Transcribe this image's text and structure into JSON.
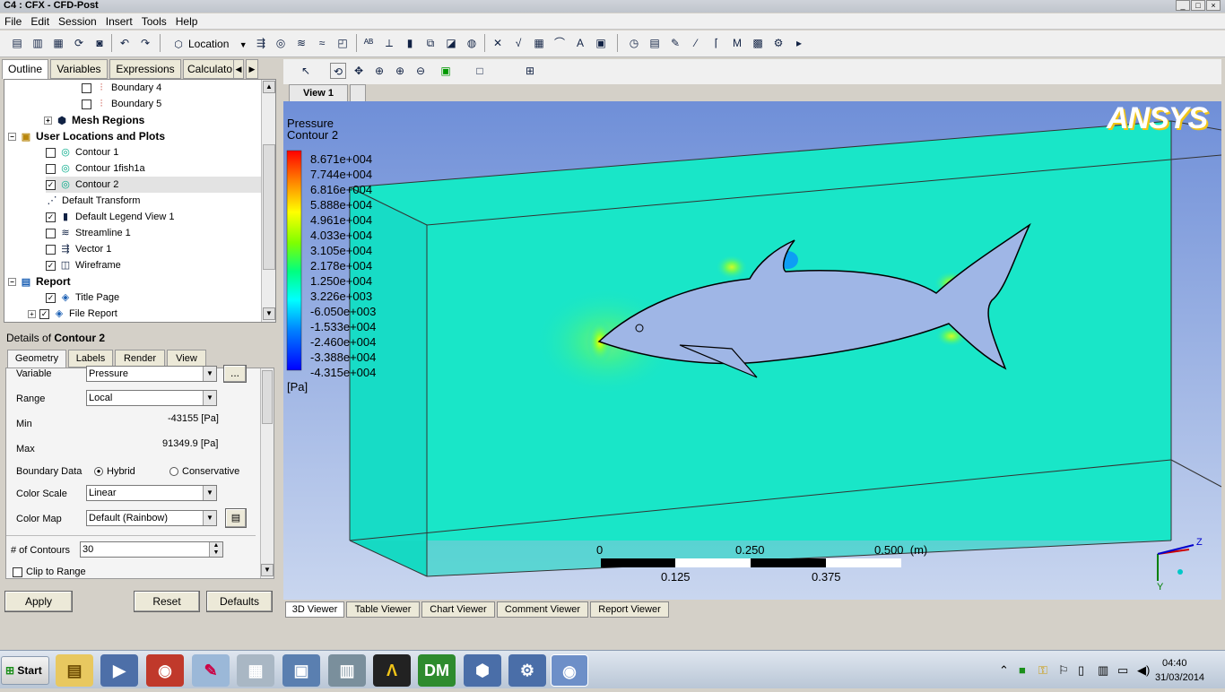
{
  "window": {
    "title": "C4 : CFX - CFD-Post"
  },
  "menu": [
    "File",
    "Edit",
    "Session",
    "Insert",
    "Tools",
    "Help"
  ],
  "toolbar": {
    "location_label": "Location"
  },
  "left_tabs": [
    "Outline",
    "Variables",
    "Expressions",
    "Calculato"
  ],
  "tree": {
    "boundary4": "Boundary 4",
    "boundary5": "Boundary 5",
    "mesh_regions": "Mesh Regions",
    "user_locations": "User Locations and Plots",
    "contour1": "Contour 1",
    "contour1fish": "Contour 1fish1a",
    "contour2": "Contour 2",
    "default_transform": "Default Transform",
    "default_legend": "Default Legend View 1",
    "streamline1": "Streamline 1",
    "vector1": "Vector 1",
    "wireframe": "Wireframe",
    "report": "Report",
    "title_page": "Title Page",
    "file_report": "File Report"
  },
  "details": {
    "prefix": "Details of ",
    "object": "Contour 2",
    "tabs": [
      "Geometry",
      "Labels",
      "Render",
      "View"
    ],
    "variable_label": "Variable",
    "variable_value": "Pressure",
    "range_label": "Range",
    "range_value": "Local",
    "min_label": "Min",
    "min_value": "-43155 [Pa]",
    "max_label": "Max",
    "max_value": "91349.9 [Pa]",
    "boundary_label": "Boundary Data",
    "hybrid": "Hybrid",
    "conservative": "Conservative",
    "color_scale_label": "Color Scale",
    "color_scale_value": "Linear",
    "color_map_label": "Color Map",
    "color_map_value": "Default (Rainbow)",
    "contours_label": "# of Contours",
    "contours_value": "30",
    "clip_label": "Clip to Range",
    "ellipsis": "..."
  },
  "buttons": {
    "apply": "Apply",
    "reset": "Reset",
    "defaults": "Defaults"
  },
  "view": {
    "tab": "View 1",
    "legend_title": "Pressure",
    "legend_subtitle": "Contour 2",
    "legend_values": [
      "8.671e+004",
      "7.744e+004",
      "6.816e+004",
      "5.888e+004",
      "4.961e+004",
      "4.033e+004",
      "3.105e+004",
      "2.178e+004",
      "1.250e+004",
      "3.226e+003",
      "-6.050e+003",
      "-1.533e+004",
      "-2.460e+004",
      "-3.388e+004",
      "-4.315e+004"
    ],
    "legend_unit": "[Pa]",
    "logo": "ANSYS",
    "scale_top": [
      "0",
      "0.250",
      "0.500  (m)"
    ],
    "scale_bottom": [
      "0.125",
      "0.375"
    ],
    "axis_z": "Z",
    "axis_y": "Y"
  },
  "viewer_tabs": [
    "3D Viewer",
    "Table Viewer",
    "Chart Viewer",
    "Comment Viewer",
    "Report Viewer"
  ],
  "taskbar": {
    "start": "Start",
    "time": "04:40",
    "date": "31/03/2014"
  },
  "colors": {
    "field": "#19e6c8",
    "box_bg_top": "#6f8fd8",
    "box_bg_bottom": "#c9d6ef",
    "ansys_yellow": "#f2c518"
  }
}
